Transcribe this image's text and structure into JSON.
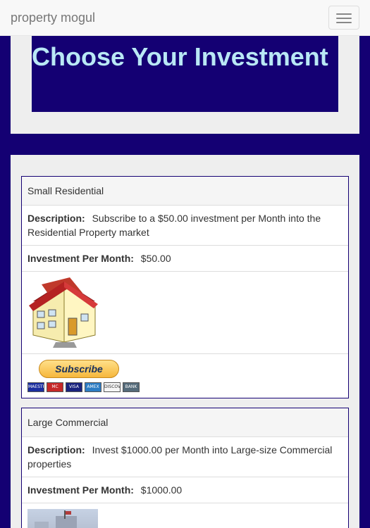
{
  "navbar": {
    "brand": "property mogul"
  },
  "hero": {
    "title": "Choose Your Investment"
  },
  "products": [
    {
      "name": "Small Residential",
      "description_label": "Description:",
      "description": "Subscribe to a $50.00 investment per Month into the Residential Property market",
      "investment_label": "Investment Per Month:",
      "investment": "$50.00",
      "image_icon": "house-icon",
      "subscribe_label": "Subscribe",
      "payment_icons": [
        "MAESTRO",
        "MC",
        "VISA",
        "AMEX",
        "DISCOVER",
        "BANK"
      ]
    },
    {
      "name": "Large Commercial",
      "description_label": "Description:",
      "description": "Invest $1000.00 per Month into Large-size Commercial properties",
      "investment_label": "Investment Per Month:",
      "investment": "$1000.00",
      "image_icon": "building-icon"
    }
  ],
  "colors": {
    "page_bg": "#140073",
    "hero_text": "#b9e8f5",
    "panel_bg": "#eeeeee",
    "card_border": "#140073"
  }
}
